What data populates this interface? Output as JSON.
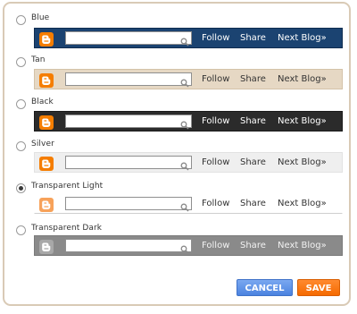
{
  "options": [
    {
      "label": "Blue",
      "checked": false,
      "bg": "#1b4371",
      "border": "#0f2d50",
      "text": "#ffffff",
      "logo": "#f57d00",
      "logo_opacity": 1
    },
    {
      "label": "Tan",
      "checked": false,
      "bg": "#e6d8c4",
      "border": "#d4c2a8",
      "text": "#333333",
      "logo": "#f57d00",
      "logo_opacity": 1
    },
    {
      "label": "Black",
      "checked": false,
      "bg": "#2b2b2b",
      "border": "#1a1a1a",
      "text": "#ffffff",
      "logo": "#f57d00",
      "logo_opacity": 1
    },
    {
      "label": "Silver",
      "checked": false,
      "bg": "#efefef",
      "border": "#e2e2e2",
      "text": "#333333",
      "logo": "#f57d00",
      "logo_opacity": 1
    },
    {
      "label": "Transparent Light",
      "checked": true,
      "bg": "#ffffff",
      "border": "#ffffff",
      "text": "#333333",
      "logo": "#f7a25a",
      "logo_opacity": 1
    },
    {
      "label": "Transparent Dark",
      "checked": false,
      "bg": "#8a8a8a",
      "border": "#7a7a7a",
      "text": "#f2f2f2",
      "logo": "#a8a8a8",
      "logo_opacity": 1
    }
  ],
  "navbar": {
    "search_value": "",
    "follow": "Follow",
    "share": "Share",
    "next_blog": "Next Blog»"
  },
  "buttons": {
    "cancel": "CANCEL",
    "save": "SAVE"
  }
}
